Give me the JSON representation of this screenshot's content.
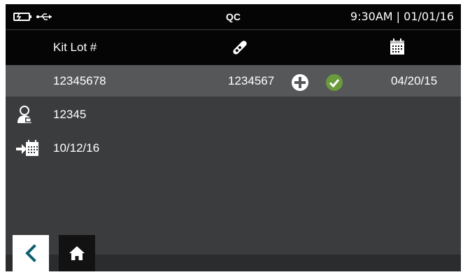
{
  "status_bar": {
    "title": "QC",
    "datetime": "9:30AM | 01/01/16",
    "icons": [
      "battery-icon",
      "usb-icon"
    ]
  },
  "header": {
    "kit_lot_label": "Kit Lot #",
    "icons": [
      "test-strip-icon",
      "calendar-icon"
    ]
  },
  "kit_row": {
    "kit_lot": "12345678",
    "strip_lot": "1234567",
    "expiry_date": "04/20/15",
    "icons": [
      "add-icon",
      "check-icon"
    ]
  },
  "info": {
    "operator_id": "12345",
    "entry_date": "10/12/16",
    "icons": [
      "user-icon",
      "calendar-arrow-icon"
    ]
  },
  "nav": {
    "icons": [
      "back-icon",
      "home-icon"
    ]
  },
  "colors": {
    "screen_bg": "#3b3c3e",
    "bar_bg": "#050505",
    "kit_row_bg": "#555759",
    "check_green": "#6a9a3c",
    "back_teal": "#0e5f73"
  }
}
